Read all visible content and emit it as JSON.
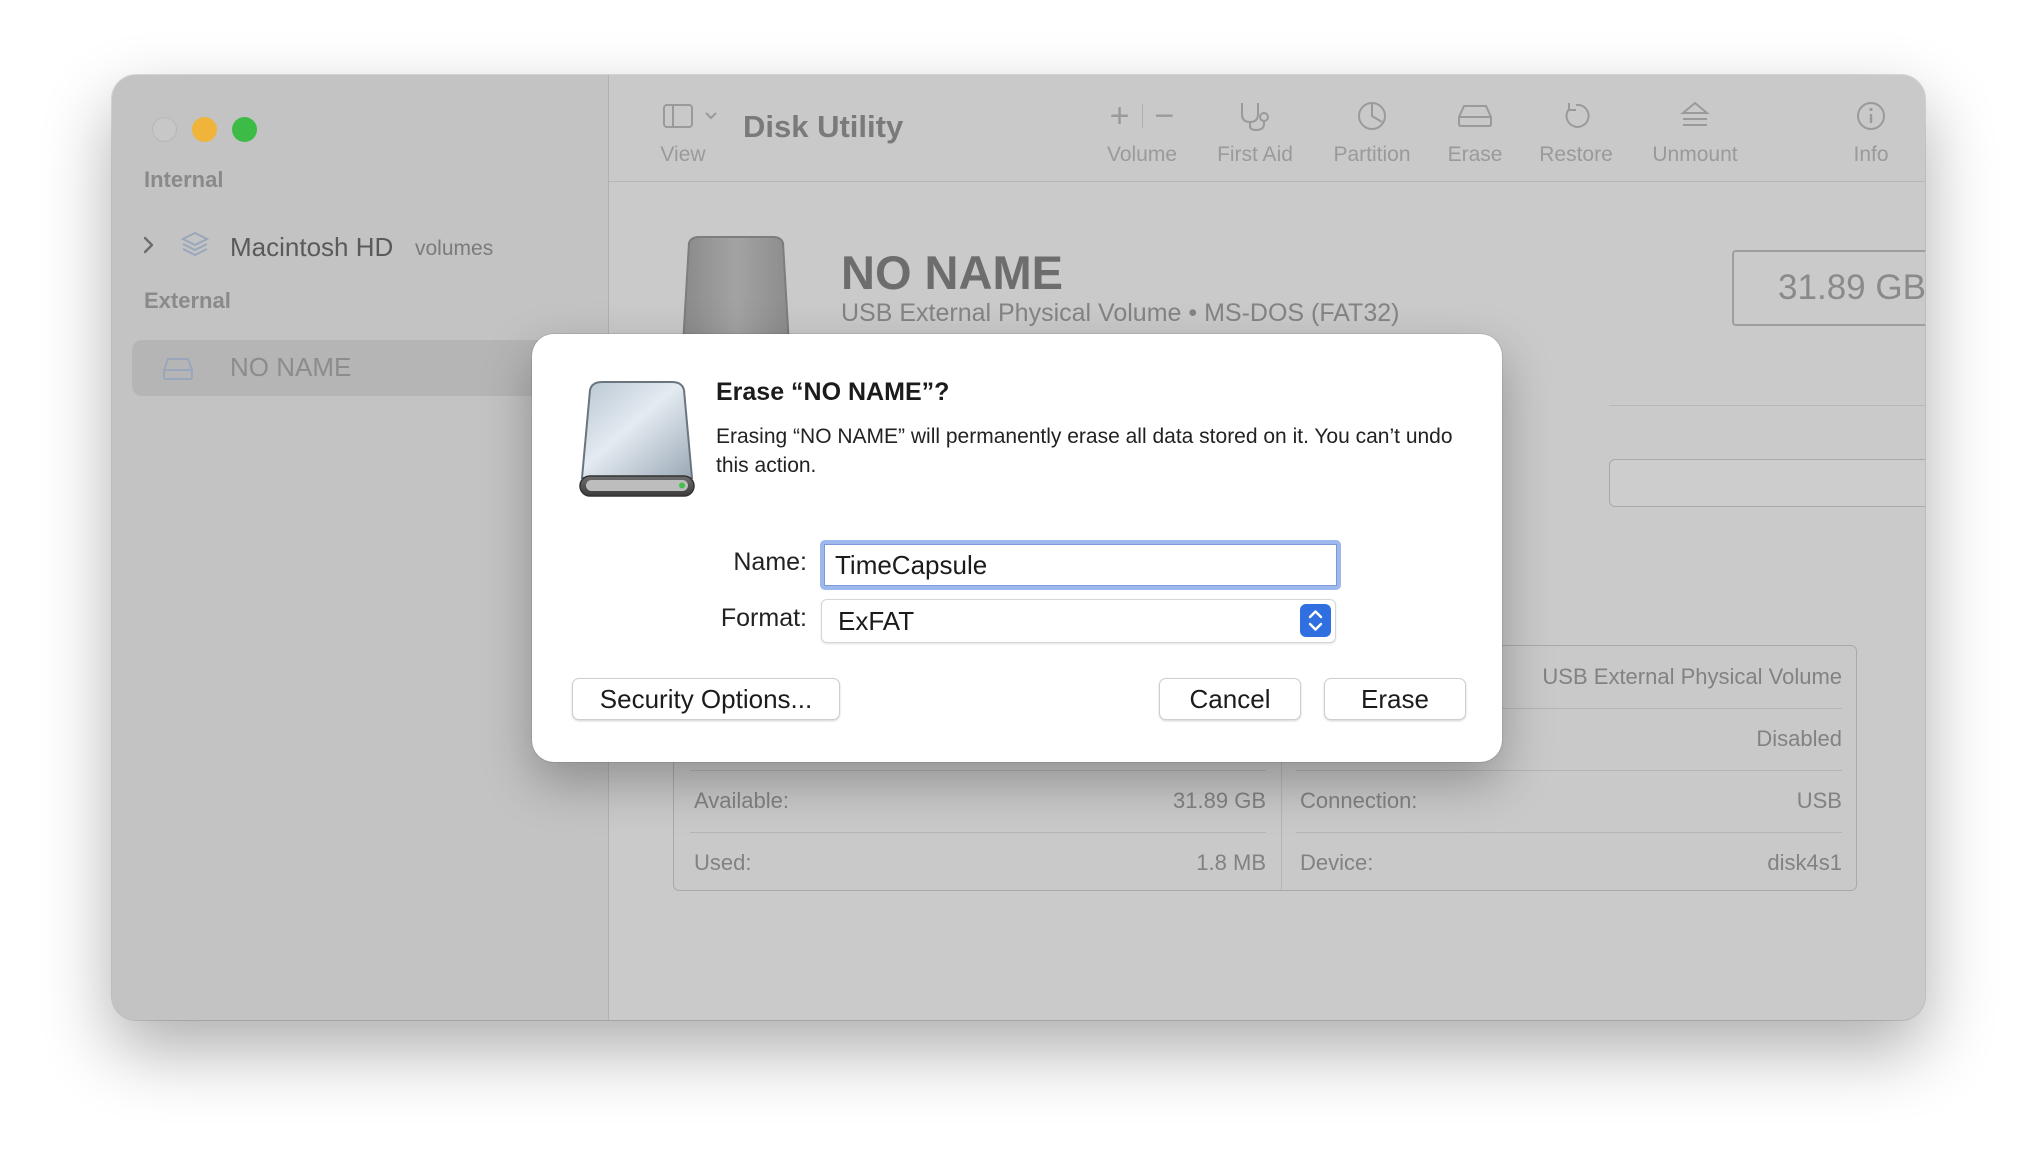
{
  "window": {
    "title": "Disk Utility"
  },
  "sidebar": {
    "internal_header": "Internal",
    "external_header": "External",
    "internal_items": [
      {
        "label": "Macintosh HD",
        "sublabel": "volumes",
        "icon": "layers-icon"
      }
    ],
    "external_items": [
      {
        "label": "NO NAME",
        "icon": "external-drive-icon",
        "selected": true
      }
    ]
  },
  "toolbar": {
    "view_label": "View",
    "volume_label": "Volume",
    "first_aid_label": "First Aid",
    "partition_label": "Partition",
    "erase_label": "Erase",
    "restore_label": "Restore",
    "unmount_label": "Unmount",
    "info_label": "Info",
    "volume_plus": "+",
    "volume_minus": "−"
  },
  "volume": {
    "name": "NO NAME",
    "description": "USB External Physical Volume • MS-DOS (FAT32)",
    "capacity": "31.89 GB"
  },
  "info": {
    "left": [
      {
        "key": "Available:",
        "value": "31.89 GB"
      },
      {
        "key": "Used:",
        "value": "1.8 MB"
      }
    ],
    "right_partial": [
      {
        "value": "USB External Physical Volume"
      },
      {
        "value": "Disabled"
      }
    ],
    "right": [
      {
        "key": "Connection:",
        "value": "USB"
      },
      {
        "key": "Device:",
        "value": "disk4s1"
      }
    ]
  },
  "dialog": {
    "title": "Erase “NO NAME”?",
    "message": "Erasing “NO NAME” will permanently erase all data stored on it. You can’t undo this action.",
    "name_label": "Name:",
    "name_value": "TimeCapsule",
    "format_label": "Format:",
    "format_value": "ExFAT",
    "security_button": "Security Options...",
    "cancel_button": "Cancel",
    "erase_button": "Erase"
  },
  "colors": {
    "accent": "#2f6fe0",
    "focus_ring": "#9cb8ec",
    "traffic_min": "#f1b43b",
    "traffic_zoom": "#3cbb46"
  }
}
